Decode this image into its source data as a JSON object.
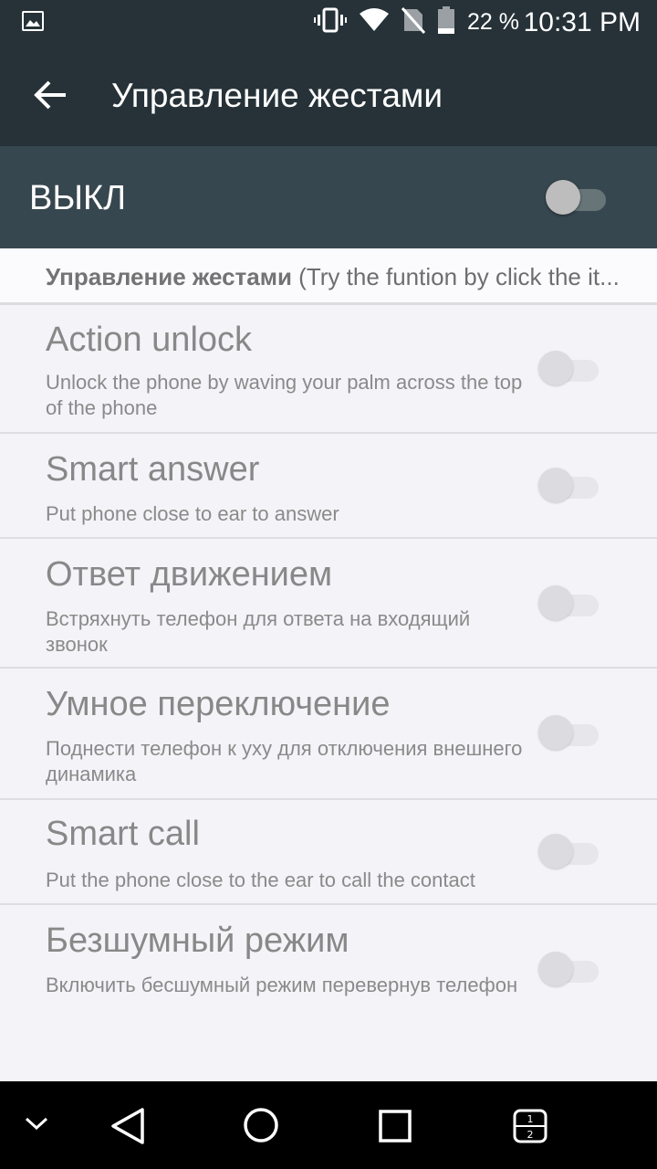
{
  "status_bar": {
    "battery_percent": "22 %",
    "time": "10:31 PM",
    "icons": [
      "image-notification-icon",
      "vibrate-icon",
      "wifi-icon",
      "no-sim-icon",
      "battery-icon"
    ]
  },
  "app_bar": {
    "title": "Управление жестами",
    "back_icon": "arrow-back-icon"
  },
  "master_switch": {
    "label": "ВЫКЛ",
    "state": "off"
  },
  "category": {
    "title": "Управление жестами",
    "hint": " (Try the funtion by click the it..."
  },
  "settings": [
    {
      "title": "Action unlock",
      "summary": "Unlock the phone by waving your palm across the top of the phone",
      "enabled": false
    },
    {
      "title": "Smart answer",
      "summary": "Put phone close to ear to answer",
      "enabled": false
    },
    {
      "title": "Ответ движением",
      "summary": "Встряхнуть телефон для ответа на входящий звонок",
      "enabled": false
    },
    {
      "title": "Умное переключение",
      "summary": "Поднести телефон к уху для отключения внешнего динамика",
      "enabled": false
    },
    {
      "title": "Smart call",
      "summary": "Put the phone close to the ear to call the contact",
      "enabled": false
    },
    {
      "title": "Безшумный режим",
      "summary": "Включить бесшумный режим перевернув телефон",
      "enabled": false
    }
  ],
  "nav_bar": {
    "buttons": [
      "hide-nav-icon",
      "back-triangle-icon",
      "home-circle-icon",
      "recents-square-icon",
      "split-screen-icon"
    ],
    "split_labels": [
      "1",
      "2"
    ]
  },
  "colors": {
    "status_bar": "#263238",
    "master_bar": "#37474f",
    "background": "#f4f3f7"
  }
}
